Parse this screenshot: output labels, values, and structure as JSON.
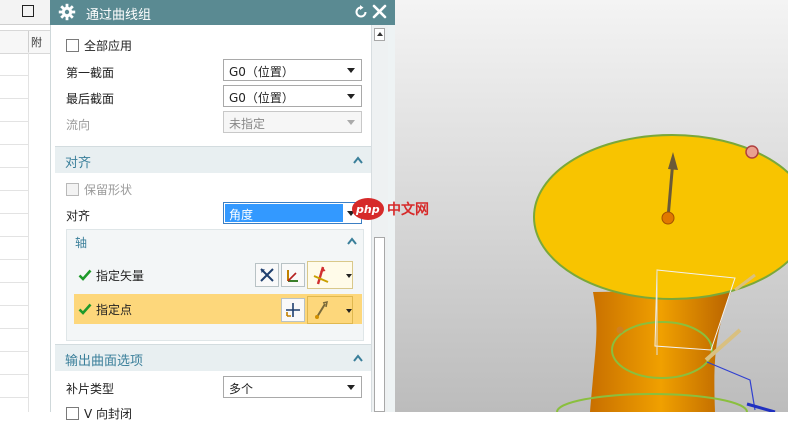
{
  "dialog": {
    "title": "通过曲线组",
    "apply_all_label": "全部应用",
    "first_section_label": "第一截面",
    "first_section_value": "G0（位置）",
    "last_section_label": "最后截面",
    "last_section_value": "G0（位置）",
    "flow_label": "流向",
    "flow_value": "未指定"
  },
  "alignment": {
    "header": "对齐",
    "keep_shape_label": "保留形状",
    "align_label": "对齐",
    "align_value": "角度",
    "axis_header": "轴",
    "specify_vector_label": "指定矢量",
    "specify_point_label": "指定点"
  },
  "output": {
    "header": "输出曲面选项",
    "patch_type_label": "补片类型",
    "patch_type_value": "多个",
    "v_closed_label": "V 向封闭"
  },
  "left_strip": {
    "column_header": "附"
  },
  "watermark": {
    "text": "php中文网"
  },
  "colors": {
    "titlebar": "#5a8a92",
    "section_text": "#3a7f9a",
    "highlight_row": "#fdd77b",
    "surface_yellow": "#f8c400",
    "surface_orange": "#d98a00",
    "viewport_bg": "#d7d7d7"
  },
  "icons": {
    "gear": "gear-icon",
    "reset": "reset-icon",
    "close": "close-icon",
    "check": "green-check-icon",
    "vector": "vector-icon",
    "point": "point-icon"
  }
}
